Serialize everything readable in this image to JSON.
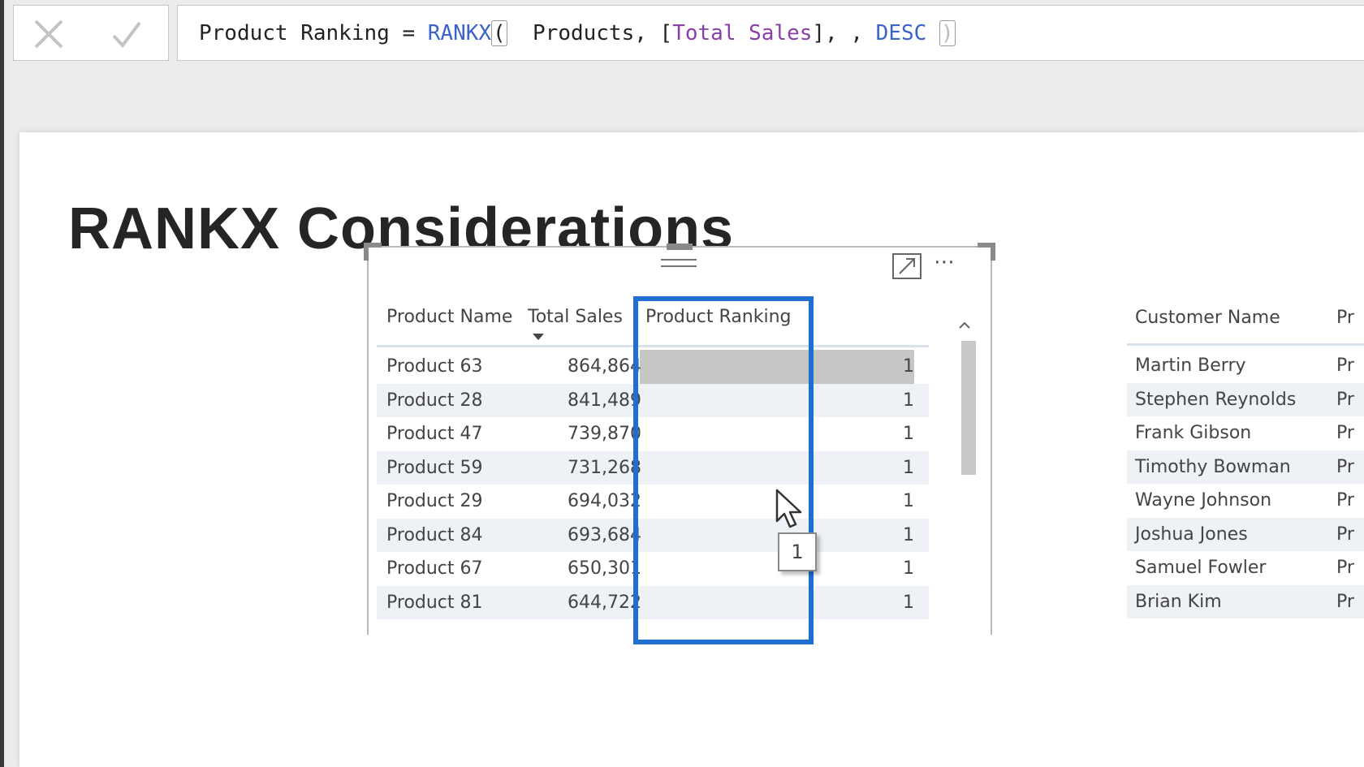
{
  "formula_bar": {
    "text_before": "Product Ranking = ",
    "function": "RANKX",
    "open_paren": "(",
    "arg_table": "  Products, [",
    "arg_column": "Total Sales",
    "arg_middle": "], , ",
    "arg_order": "DESC",
    "space": " ",
    "close_paren": ")"
  },
  "page": {
    "title": "RANKX Considerations"
  },
  "table": {
    "headers": {
      "product_name": "Product Name",
      "total_sales": "Total Sales",
      "product_ranking": "Product Ranking"
    },
    "more_options": "⋯",
    "rows": [
      {
        "name": "Product 63",
        "sales": "864,864",
        "rank": "1"
      },
      {
        "name": "Product 28",
        "sales": "841,489",
        "rank": "1"
      },
      {
        "name": "Product 47",
        "sales": "739,870",
        "rank": "1"
      },
      {
        "name": "Product 59",
        "sales": "731,268",
        "rank": "1"
      },
      {
        "name": "Product 29",
        "sales": "694,032",
        "rank": "1"
      },
      {
        "name": "Product 84",
        "sales": "693,684",
        "rank": "1"
      },
      {
        "name": "Product 67",
        "sales": "650,301",
        "rank": "1"
      },
      {
        "name": "Product 81",
        "sales": "644,722",
        "rank": "1"
      }
    ],
    "tooltip": "1"
  },
  "customer_table": {
    "headers": {
      "customer_name": "Customer Name",
      "product": "Pr"
    },
    "rows": [
      {
        "name": "Martin Berry",
        "product": "Pr"
      },
      {
        "name": "Stephen Reynolds",
        "product": "Pr"
      },
      {
        "name": "Frank Gibson",
        "product": "Pr"
      },
      {
        "name": "Timothy Bowman",
        "product": "Pr"
      },
      {
        "name": "Wayne Johnson",
        "product": "Pr"
      },
      {
        "name": "Joshua Jones",
        "product": "Pr"
      },
      {
        "name": "Samuel Fowler",
        "product": "Pr"
      },
      {
        "name": "Brian Kim",
        "product": "Pr"
      }
    ]
  },
  "colors": {
    "highlight_border": "#1f6fd1",
    "function_blue": "#3b63c9",
    "column_purple": "#8a3fa8"
  }
}
